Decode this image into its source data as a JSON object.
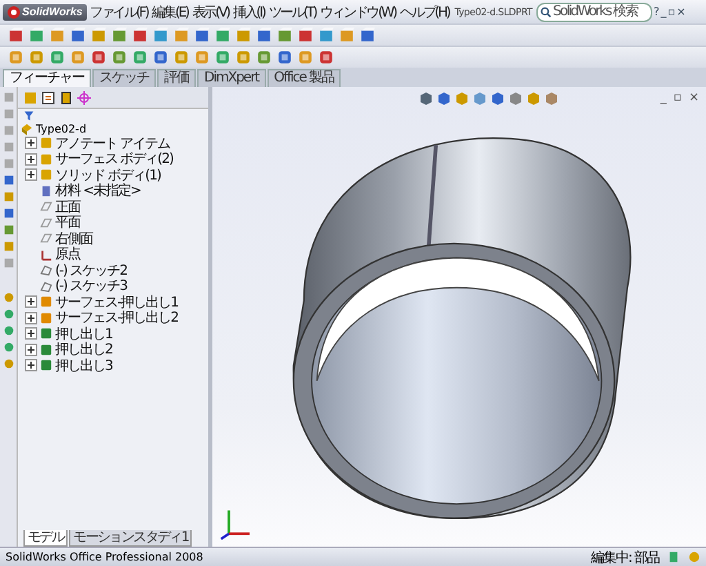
{
  "app": {
    "logo": "SolidWorks"
  },
  "menu": [
    "ファイル(F)",
    "編集(E)",
    "表示(V)",
    "挿入(I)",
    "ツール(T)",
    "ウィンドウ(W)",
    "ヘルプ(H)"
  ],
  "window": {
    "title": "Type02-d.SLDPRT"
  },
  "search": {
    "placeholder": "SolidWorks 検索"
  },
  "title_controls": [
    "?",
    "_",
    "▫",
    "×"
  ],
  "command_tabs": [
    {
      "label": "フィーチャー",
      "selected": true
    },
    {
      "label": "スケッチ",
      "selected": false
    },
    {
      "label": "評価",
      "selected": false
    },
    {
      "label": "DimXpert",
      "selected": false
    },
    {
      "label": "Office 製品",
      "selected": false
    }
  ],
  "feature_tree": {
    "root": "Type02-d",
    "children": [
      {
        "label": "アノテート アイテム",
        "kind": "annotation",
        "expandable": true
      },
      {
        "label": "サーフェス ボディ(2)",
        "kind": "body",
        "expandable": true
      },
      {
        "label": "ソリッド ボディ(1)",
        "kind": "body",
        "expandable": true
      },
      {
        "label": "材料 <未指定>",
        "kind": "material",
        "expandable": false
      },
      {
        "label": "正面",
        "kind": "plane",
        "expandable": false
      },
      {
        "label": "平面",
        "kind": "plane",
        "expandable": false
      },
      {
        "label": "右側面",
        "kind": "plane",
        "expandable": false
      },
      {
        "label": "原点",
        "kind": "origin",
        "expandable": false
      },
      {
        "label": "(-) スケッチ2",
        "kind": "sketch",
        "expandable": false
      },
      {
        "label": "(-) スケッチ3",
        "kind": "sketch",
        "expandable": false
      },
      {
        "label": "サーフェス-押し出し1",
        "kind": "surface",
        "expandable": true
      },
      {
        "label": "サーフェス-押し出し2",
        "kind": "surface",
        "expandable": true
      },
      {
        "label": "押し出し1",
        "kind": "extrude",
        "expandable": true
      },
      {
        "label": "押し出し2",
        "kind": "extrude",
        "expandable": true
      },
      {
        "label": "押し出し3",
        "kind": "extrude",
        "expandable": true
      }
    ]
  },
  "view_controls": [
    "_",
    "▫",
    "×"
  ],
  "bottom_tabs": [
    {
      "label": "モデル",
      "selected": true
    },
    {
      "label": "モーションスタディ1",
      "selected": false
    }
  ],
  "status_bar": {
    "product": "SolidWorks Office Professional 2008",
    "mode": "編集中: 部品"
  }
}
